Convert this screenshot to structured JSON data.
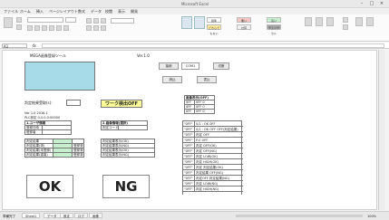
{
  "window": {
    "title": "Microsoft Excel",
    "minimize": "–",
    "maximize": "□",
    "close": "×"
  },
  "menu": [
    "ファイル",
    "ホーム",
    "挿入",
    "ページレイアウト",
    "数式",
    "データ",
    "校閲",
    "表示",
    "開発"
  ],
  "formula": {
    "name_box": "A1",
    "fx": "fx"
  },
  "ribbon": {
    "styles": [
      {
        "label": "標準",
        "color": "#ffffff"
      },
      {
        "label": "悪い",
        "color": "#f4c7c3"
      },
      {
        "label": "良い",
        "color": "#c6efce"
      },
      {
        "label": "どちらでもない",
        "color": "#ffeb9c"
      },
      {
        "label": "計算",
        "color": "#f2f2f2"
      },
      {
        "label": "チェックセル",
        "color": "#a5a5a5"
      }
    ]
  },
  "sheet": {
    "header": "MEGA画像登録ツール",
    "version": "Ver.1.0",
    "top_buttons": {
      "connect": "接続",
      "port_select": "COM1",
      "disconnect": "切断",
      "read": "読込",
      "write": "書込"
    },
    "scan_label": "判定結果受取(s):",
    "scan_value": "",
    "work_status": "ワーク検出OFF",
    "info_lines": [
      "Ver 1.0  2016.1",
      "PLC設定  0.0.0.0:00000"
    ],
    "table_a_title": "1.ユーザ情報",
    "table_a_rows": [
      "登録日時",
      "登録者"
    ],
    "table_b_title": "2.画像情報(選択)",
    "table_b_rows": [
      "判定コード",
      ""
    ],
    "result_left": [
      {
        "label": "判定結果",
        "status": ""
      },
      {
        "label": "判定結果(済)",
        "status": "登録済"
      },
      {
        "label": "判定結果(未登録)",
        "status": "登録済"
      },
      {
        "label": "判定結果(重複)",
        "status": "登録済"
      }
    ],
    "result_right": [
      "判定結果表示(OK)",
      "判定結果表示(NG)",
      "判定結果表示(OK)",
      "判定結果表示(NG)"
    ],
    "small_table_title": "画像表示(OFF)",
    "small_table_rows": [
      {
        "k": "0FF",
        "v": "0FF 0"
      },
      {
        "k": "0FF",
        "v": "0FF 0"
      },
      {
        "k": "0FF",
        "v": "0FF 0"
      }
    ],
    "list_rows": [
      {
        "k": "\"0FF\"",
        "v": "0/1 : OK  0FF"
      },
      {
        "k": "\"0FF\"",
        "v": "0/1 : OK OFF OFF(判定結果)"
      },
      {
        "k": "\"0FF\"",
        "v": "判定 OFF"
      },
      {
        "k": "\"0FF\"",
        "v": "P-0 OFF"
      },
      {
        "k": "\"0FF\"",
        "v": "判定 OFF(OK)"
      },
      {
        "k": "\"0FF\"",
        "v": "判定 OFF(NG)"
      },
      {
        "k": "\"0FF\"",
        "v": "判定 LOW(OK)"
      },
      {
        "k": "\"0FF\"",
        "v": "判定 HIGH(OK)"
      },
      {
        "k": "\"0FF\"",
        "v": "判定 判定結果(OK)"
      },
      {
        "k": "\"0FF\"",
        "v": "判定結果 OFF(NG)"
      },
      {
        "k": "\"0FF\"",
        "v": "判定OFF 判定結果(NG)"
      },
      {
        "k": "\"0FF\"",
        "v": "判定 LOW(NG)"
      },
      {
        "k": "\"0FF\"",
        "v": "判定 HIGH(NG)"
      }
    ],
    "ok_label": "OK",
    "ng_label": "NG"
  },
  "status": {
    "ready": "準備完了",
    "tabs": [
      "Sheet1",
      "データ",
      "設定",
      "ログ",
      "画像"
    ],
    "zoom": "100%"
  },
  "colors": {
    "preview_fill": "#a7dbe8",
    "status_fill": "#ffff99",
    "green_fill": "#c6efce"
  }
}
